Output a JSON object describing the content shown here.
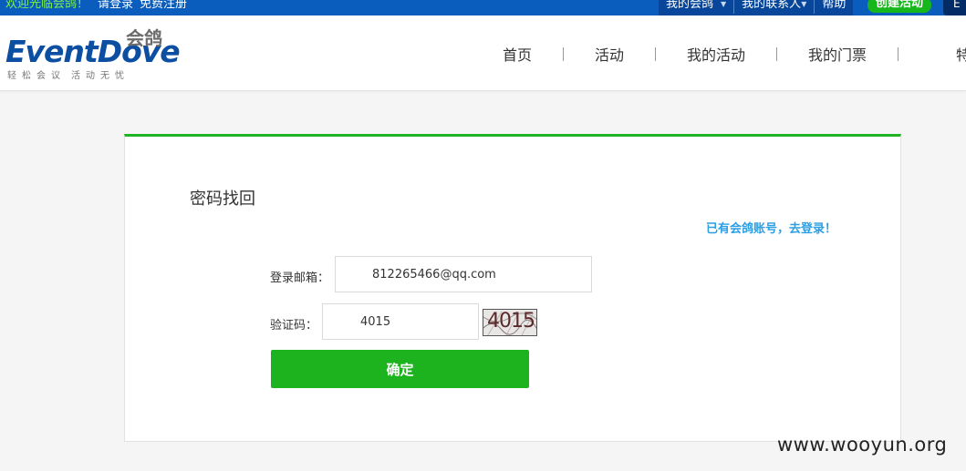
{
  "topbar": {
    "welcome": "欢迎光临会鸽！",
    "login": "请登录",
    "register": "免费注册",
    "my_eventdove": "我的会鸽",
    "contacts": "我的联系人",
    "help": "帮助",
    "create_event": "创建活动",
    "lang": "E"
  },
  "logo": {
    "brand_event": "Event",
    "brand_dove": "Dove",
    "cn_name": "会鸽",
    "tagline_left": "轻松会议",
    "tagline_right": "活动无忧"
  },
  "nav": {
    "items": [
      "首页",
      "活动",
      "我的活动",
      "我的门票"
    ],
    "last_partial": "特"
  },
  "form": {
    "title": "密码找回",
    "login_link": "已有会鸽账号，去登录！",
    "email_label": "登录邮箱：",
    "email_value": "812265466@qq.com",
    "captcha_label": "验证码：",
    "captcha_value": "4015",
    "captcha_image_text": "4015",
    "submit": "确定"
  },
  "watermark": "www.wooyun.org",
  "colors": {
    "topbar": "#0a5dbd",
    "accent_green": "#1cb31f",
    "link_blue": "#2b9fe3"
  }
}
